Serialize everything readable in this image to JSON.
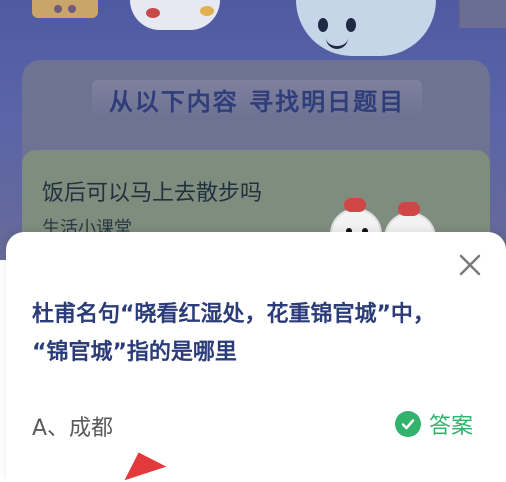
{
  "background": {
    "banner_text": "从以下内容 寻找明日题目",
    "hint_card": {
      "title": "饭后可以马上去散步吗",
      "subtitle": "生活小课堂"
    }
  },
  "sheet": {
    "question": "杜甫名句“晓看红湿处，花重锦官城”中，\n“锦官城”指的是哪里",
    "option_a": "A、成都",
    "answer_label": "答案",
    "close_icon": "close-icon"
  },
  "colors": {
    "primary": "#2b3c78",
    "answer_green": "#31b36b",
    "overlay_purple": "#5b64a8",
    "arrow_red": "#e23a3a"
  }
}
